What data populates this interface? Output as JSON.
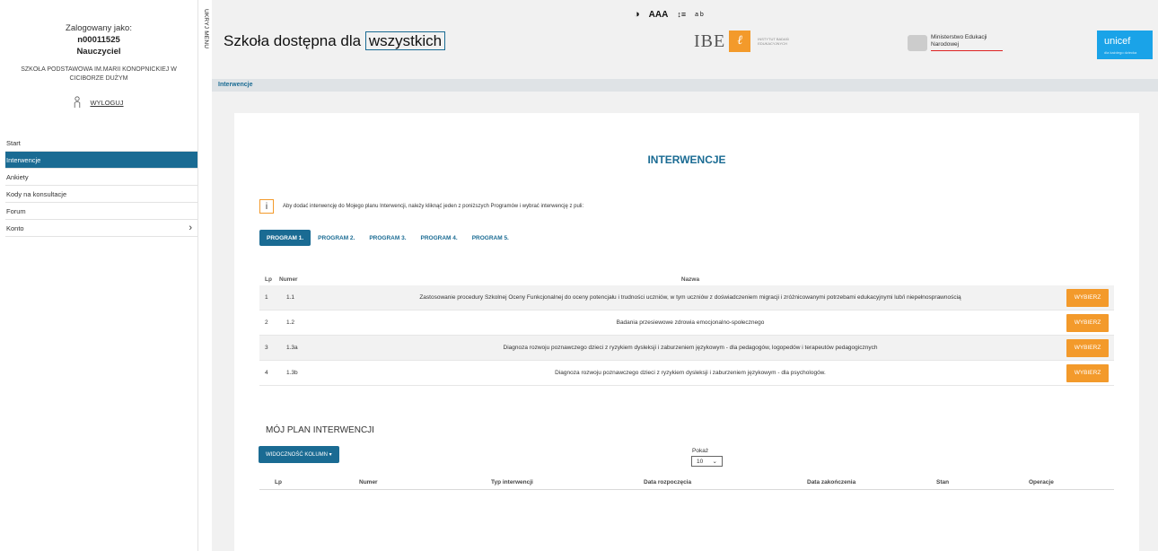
{
  "sidebar": {
    "login_label": "Zalogowany jako:",
    "user_id": "n00011525",
    "role": "Nauczyciel",
    "school": "SZKOŁA PODSTAWOWA IM.MARII KONOPNICKIEJ W CICIBORZE DUŻYM",
    "logout": "WYLOGUJ",
    "hide_menu": "UKRYJ MENU",
    "items": [
      {
        "label": "Start"
      },
      {
        "label": "Interwencje"
      },
      {
        "label": "Ankiety"
      },
      {
        "label": "Kody na konsultacje"
      },
      {
        "label": "Forum"
      },
      {
        "label": "Konto",
        "chevron": "›"
      }
    ]
  },
  "accessibility": {
    "contrast": "◑",
    "font_size": "AAA",
    "line_height": "↕≡",
    "letter_spacing": "a b"
  },
  "header": {
    "title_prefix": "Szkoła dostępna dla",
    "title_boxed": "wszystkich",
    "ibe_text": "IBE",
    "ibe_sub": "INSTYTUT BADAŃ EDUKACYJNYCH",
    "men_text": "Ministerstwo Edukacji Narodowej",
    "unicef_text": "unicef",
    "unicef_sub": "dla każdego dziecka"
  },
  "breadcrumb": "Interwencje",
  "main": {
    "title": "INTERWENCJE",
    "info_icon": "i",
    "info_text": "Aby dodać interwencję do Mojego planu Interwencji, należy kliknąć jeden z poniższych Programów i wybrać interwencję z puli:",
    "tabs": [
      "PROGRAM 1.",
      "PROGRAM 2.",
      "PROGRAM 3.",
      "PROGRAM 4.",
      "PROGRAM 5."
    ],
    "table": {
      "headers": {
        "lp": "Lp",
        "numer": "Numer",
        "nazwa": "Nazwa"
      },
      "button_label": "WYBIERZ",
      "rows": [
        {
          "lp": "1",
          "numer": "1.1",
          "nazwa": "Zastosowanie procedury Szkolnej Oceny Funkcjonalnej do oceny potencjału i trudności uczniów, w tym uczniów z doświadczeniem migracji i zróżnicowanymi potrzebami edukacyjnymi lub/i niepełnosprawnością"
        },
        {
          "lp": "2",
          "numer": "1.2",
          "nazwa": "Badania przesiewowe zdrowia emocjonalno-społecznego"
        },
        {
          "lp": "3",
          "numer": "1.3a",
          "nazwa": "Diagnoza rozwoju poznawczego dzieci z ryzykiem dysleksji i zaburzeniem językowym - dla pedagogów, logopedów i terapeutów pedagogicznych"
        },
        {
          "lp": "4",
          "numer": "1.3b",
          "nazwa": "Diagnoza rozwoju poznawczego dzieci z ryzykiem dysleksji i zaburzeniem językowym - dla psychologów."
        }
      ]
    },
    "plan": {
      "title": "MÓJ PLAN INTERWENCJI",
      "columns_button": "WIDOCZNOŚĆ KOLUMN ▾",
      "show_label": "Pokaż",
      "show_value": "10",
      "headers": [
        "Lp",
        "Numer",
        "Typ interwencji",
        "Data rozpoczęcia",
        "Data zakończenia",
        "Stan",
        "Operacje"
      ]
    }
  }
}
